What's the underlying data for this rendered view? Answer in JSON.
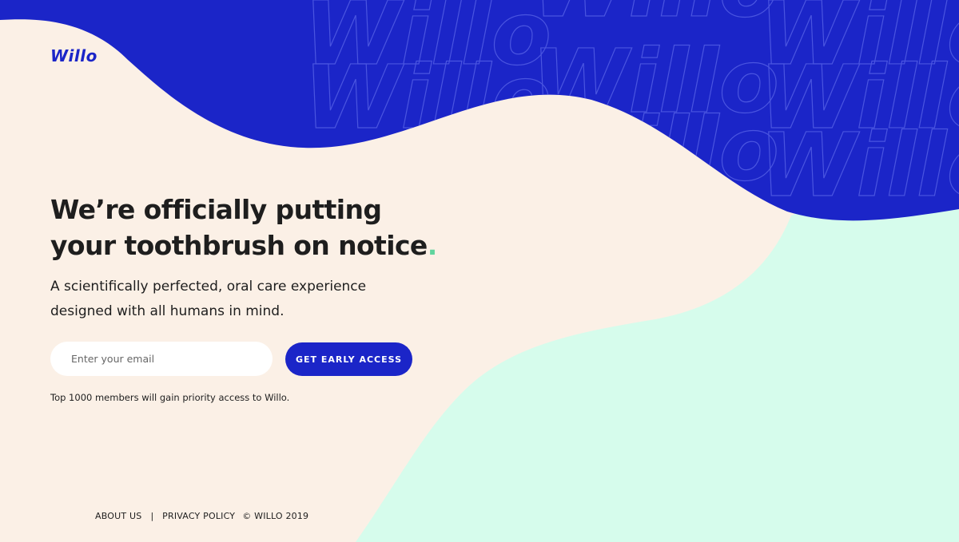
{
  "brand": {
    "logo_text": "Willo",
    "watermark_text": "Willo",
    "colors": {
      "primary_blue": "#1b25c8",
      "cream": "#fbf0e6",
      "mint": "#d6fcec",
      "accent_green": "#5fd49d",
      "text_dark": "#1e1e1e"
    }
  },
  "hero": {
    "headline_line1": "We’re officially putting",
    "headline_line2": "your toothbrush on notice",
    "headline_dot": ".",
    "subhead_line1": "A scientifically perfected, oral care experience",
    "subhead_line2": "designed with all humans in mind."
  },
  "signup": {
    "email_placeholder": "Enter your email",
    "email_value": "",
    "cta_label": "GET EARLY ACCESS",
    "note": "Top 1000 members will gain priority access to Willo."
  },
  "footer": {
    "about_label": "ABOUT US",
    "separator": "|",
    "privacy_label": "PRIVACY POLICY",
    "copyright": "© WILLO 2019"
  }
}
